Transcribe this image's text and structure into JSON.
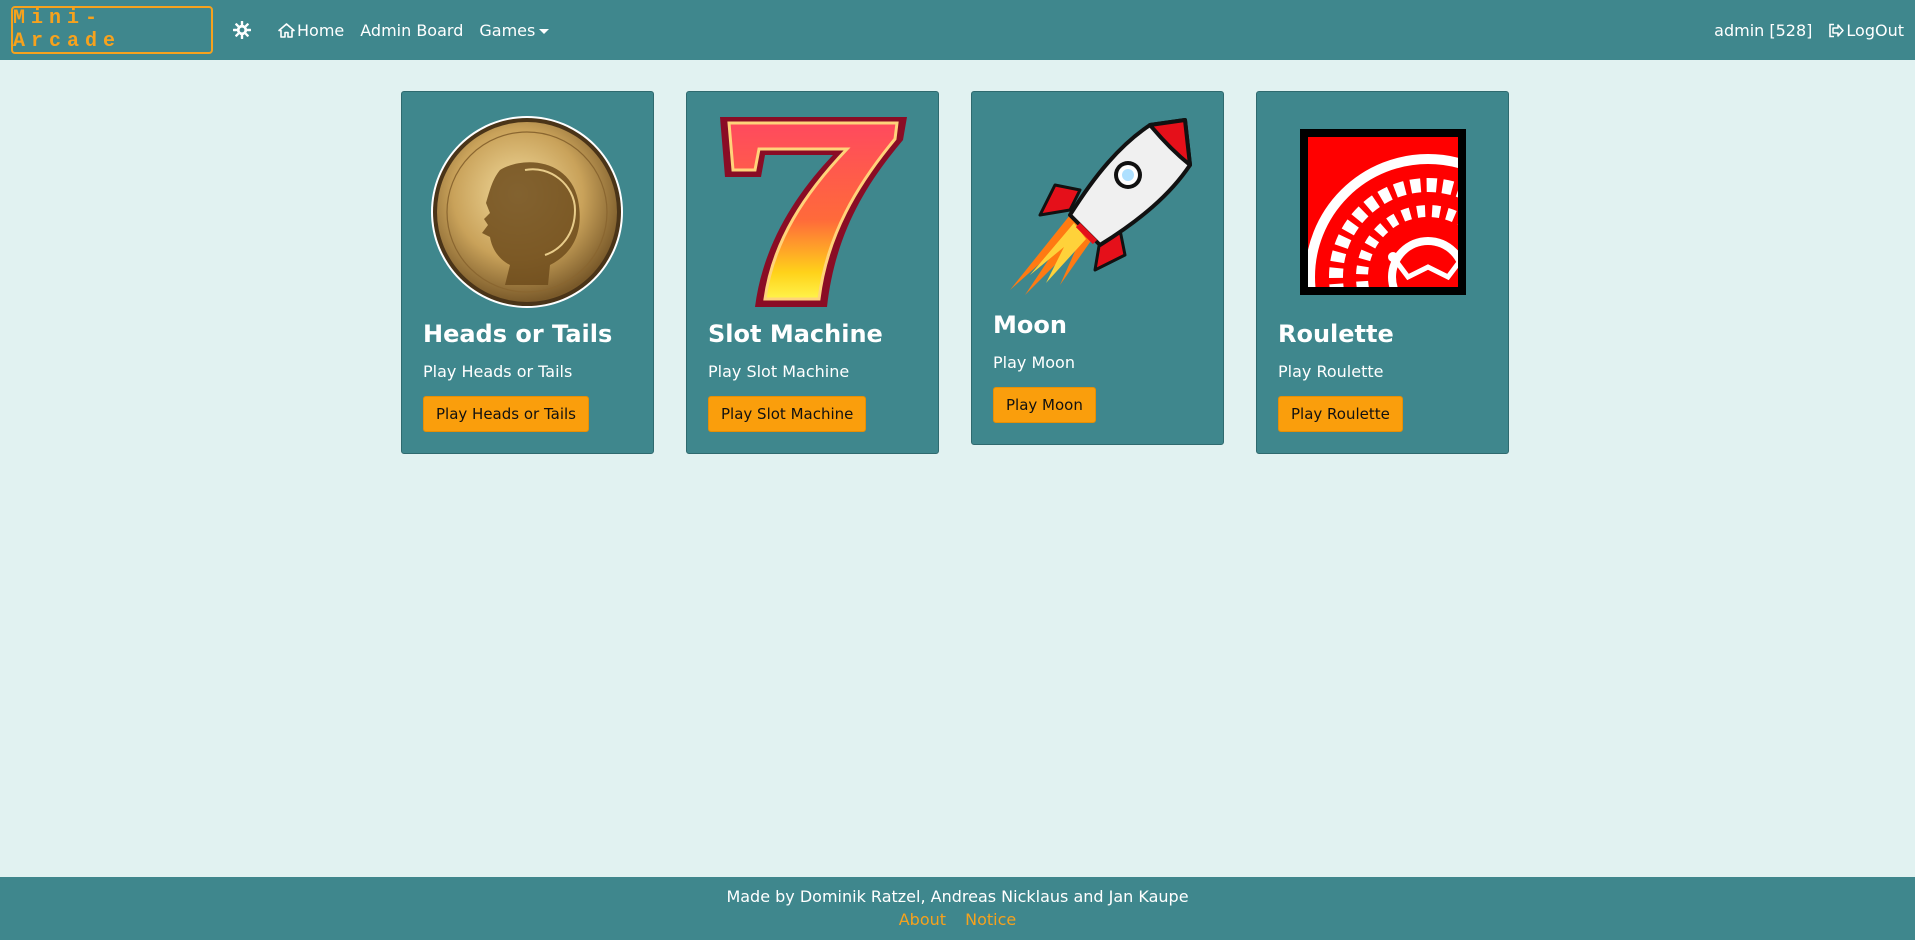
{
  "navbar": {
    "brand": "Mini-Arcade",
    "theme_icon": "gear-icon",
    "links": {
      "home": "Home",
      "admin_board": "Admin Board",
      "games": "Games"
    },
    "user": "admin [528]",
    "logout": "LogOut"
  },
  "cards": [
    {
      "title": "Heads or Tails",
      "text": "Play Heads or Tails",
      "button": "Play Heads or Tails",
      "icon": "coin-icon"
    },
    {
      "title": "Slot Machine",
      "text": "Play Slot Machine",
      "button": "Play Slot Machine",
      "icon": "lucky-seven-icon"
    },
    {
      "title": "Moon",
      "text": "Play Moon",
      "button": "Play Moon",
      "icon": "rocket-icon"
    },
    {
      "title": "Roulette",
      "text": "Play Roulette",
      "button": "Play Roulette",
      "icon": "roulette-wheel-icon"
    }
  ],
  "footer": {
    "credits": "Made by Dominik Ratzel, Andreas Nicklaus and Jan Kaupe",
    "about": "About",
    "notice": "Notice"
  },
  "colors": {
    "background": "#e1f2f1",
    "navbar": "#3f878d",
    "accent": "#fa9e0c"
  }
}
